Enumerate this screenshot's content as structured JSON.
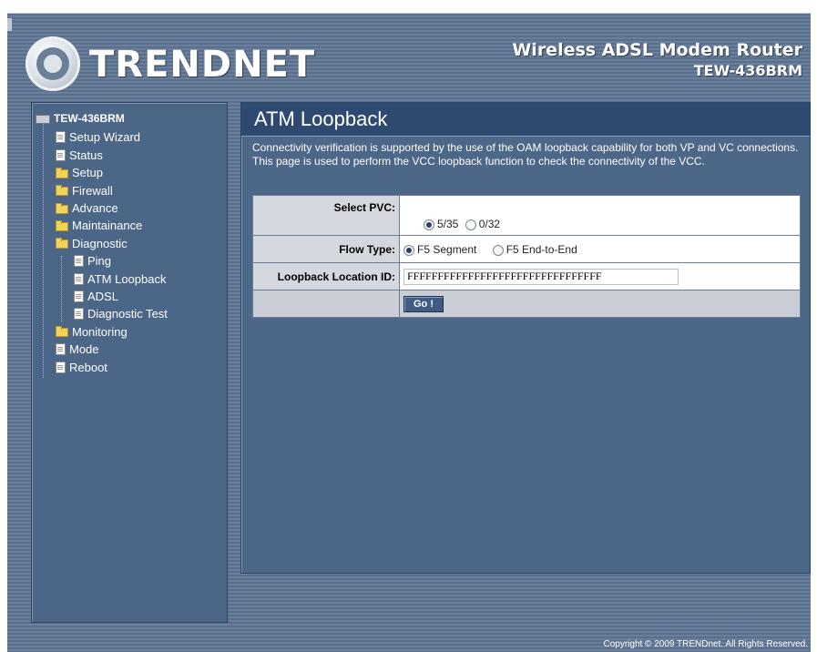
{
  "brand": {
    "logo_text": "TRENDNET"
  },
  "product": {
    "name": "Wireless ADSL Modem Router",
    "model": "TEW-436BRM"
  },
  "sidebar": {
    "root": "TEW-436BRM",
    "items": [
      {
        "label": "Setup Wizard",
        "icon": "document-icon"
      },
      {
        "label": "Status",
        "icon": "document-icon"
      },
      {
        "label": "Setup",
        "icon": "folder-icon"
      },
      {
        "label": "Firewall",
        "icon": "folder-icon"
      },
      {
        "label": "Advance",
        "icon": "folder-icon"
      },
      {
        "label": "Maintainance",
        "icon": "folder-icon"
      },
      {
        "label": "Diagnostic",
        "icon": "folder-open-icon"
      },
      {
        "label": "Ping",
        "icon": "document-icon"
      },
      {
        "label": "ATM Loopback",
        "icon": "document-icon"
      },
      {
        "label": "ADSL",
        "icon": "document-icon"
      },
      {
        "label": "Diagnostic Test",
        "icon": "document-icon"
      },
      {
        "label": "Monitoring",
        "icon": "folder-icon"
      },
      {
        "label": "Mode",
        "icon": "document-icon"
      },
      {
        "label": "Reboot",
        "icon": "document-icon"
      }
    ]
  },
  "main": {
    "title": "ATM Loopback",
    "description": "Connectivity verification is supported by the use of the OAM loopback capability for both VP and VC connections. This page is used to perform the VCC loopback function to check the connectivity of the VCC.",
    "select_pvc": {
      "label": "Select PVC:",
      "options": [
        "5/35",
        "0/32"
      ],
      "selected": "5/35"
    },
    "flow_type": {
      "label": "Flow Type:",
      "options": [
        "F5 Segment",
        "F5 End-to-End"
      ],
      "selected": "F5 Segment"
    },
    "loopback_id": {
      "label": "Loopback Location ID:",
      "value": "FFFFFFFFFFFFFFFFFFFFFFFFFFFFFFFF"
    },
    "go_button": "Go !"
  },
  "footer": {
    "copyright": "Copyright © 2009 TRENDnet. All Rights Reserved."
  }
}
